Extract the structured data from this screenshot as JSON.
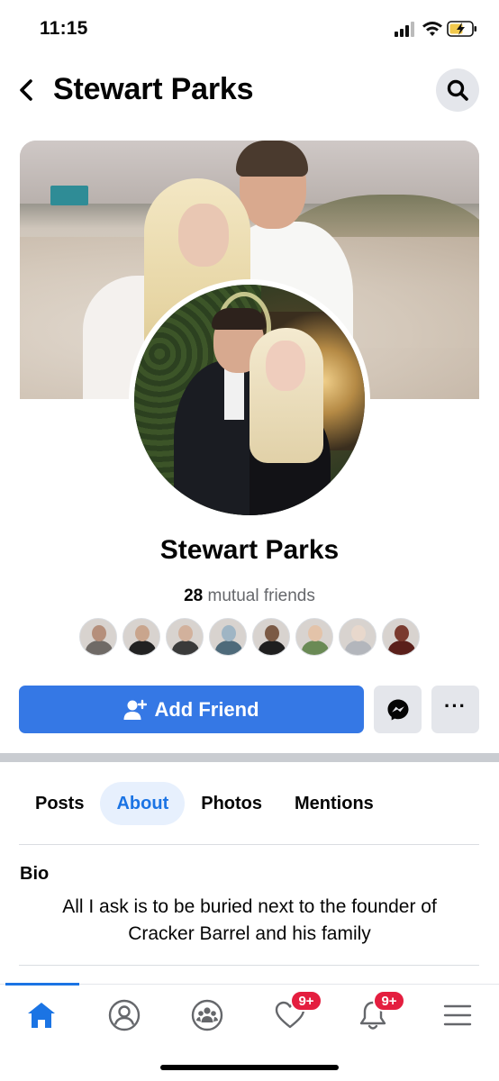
{
  "status_bar": {
    "time": "11:15"
  },
  "header": {
    "title": "Stewart Parks"
  },
  "profile": {
    "name": "Stewart Parks",
    "mutual_count": "28",
    "mutual_label": "mutual friends"
  },
  "mutual_friend_avatars": [
    {
      "head": "#b58f7b",
      "body": "#6f6a66"
    },
    {
      "head": "#c9a58d",
      "body": "#222222"
    },
    {
      "head": "#d2b19c",
      "body": "#3a3a3a"
    },
    {
      "head": "#9fb5c4",
      "body": "#4e6a7a"
    },
    {
      "head": "#7b5a45",
      "body": "#1f1f1f"
    },
    {
      "head": "#e3c3a9",
      "body": "#6a8a55"
    },
    {
      "head": "#e8d8cc",
      "body": "#b3b6bc"
    },
    {
      "head": "#7a3a2e",
      "body": "#5a1f1a"
    }
  ],
  "actions": {
    "add_friend": "Add Friend"
  },
  "tabs": [
    {
      "label": "Posts",
      "active": false
    },
    {
      "label": "About",
      "active": true
    },
    {
      "label": "Photos",
      "active": false
    },
    {
      "label": "Mentions",
      "active": false
    }
  ],
  "bio": {
    "heading": "Bio",
    "text": "All I ask is to be buried next to the founder of Cracker Barrel and his family"
  },
  "bottom_nav": {
    "items": [
      {
        "icon": "home-icon",
        "active": true
      },
      {
        "icon": "profile-icon",
        "active": false
      },
      {
        "icon": "groups-icon",
        "active": false
      },
      {
        "icon": "dating-heart-icon",
        "active": false,
        "badge": "9+"
      },
      {
        "icon": "bell-icon",
        "active": false,
        "badge": "9+"
      },
      {
        "icon": "menu-icon",
        "active": false
      }
    ]
  },
  "colors": {
    "accent": "#1b74e4",
    "button_blue": "#3578e5",
    "badge_red": "#e41e3f",
    "secondary_button": "#e4e6eb"
  }
}
